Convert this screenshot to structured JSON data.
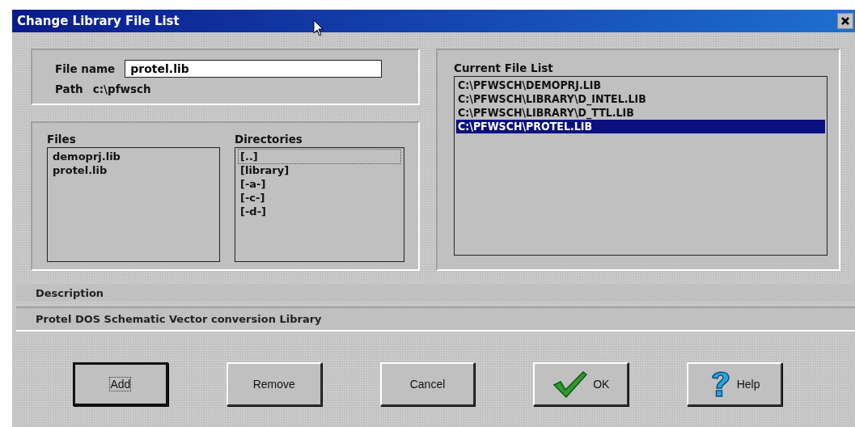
{
  "window": {
    "title": "Change Library File List"
  },
  "file_name": {
    "label": "File name",
    "value": "protel.lib"
  },
  "path": {
    "label": "Path",
    "value": "c:\\pfwsch"
  },
  "files": {
    "label": "Files",
    "items": [
      {
        "text": "demoprj.lib",
        "selected": false
      },
      {
        "text": "protel.lib",
        "selected": false
      }
    ]
  },
  "directories": {
    "label": "Directories",
    "items": [
      {
        "text": "[..]",
        "selected": true
      },
      {
        "text": "[library]",
        "selected": false
      },
      {
        "text": "[-a-]",
        "selected": false
      },
      {
        "text": "[-c-]",
        "selected": false
      },
      {
        "text": "[-d-]",
        "selected": false
      }
    ]
  },
  "current_file_list": {
    "label": "Current File List",
    "items": [
      {
        "text": "C:\\PFWSCH\\DEMOPRJ.LIB",
        "selected": false
      },
      {
        "text": "C:\\PFWSCH\\LIBRARY\\D_INTEL.LIB",
        "selected": false
      },
      {
        "text": "C:\\PFWSCH\\LIBRARY\\D_TTL.LIB",
        "selected": false
      },
      {
        "text": "C:\\PFWSCH\\PROTEL.LIB",
        "selected": true
      }
    ]
  },
  "description": {
    "label": "Description",
    "value": "Protel DOS Schematic Vector conversion Library"
  },
  "buttons": [
    {
      "label": "Add",
      "kind": "plain",
      "focused": true
    },
    {
      "label": "Remove",
      "kind": "plain",
      "focused": false
    },
    {
      "label": "Cancel",
      "kind": "plain",
      "focused": false
    },
    {
      "label": "OK",
      "kind": "ok",
      "focused": false
    },
    {
      "label": "Help",
      "kind": "help",
      "focused": false
    }
  ]
}
